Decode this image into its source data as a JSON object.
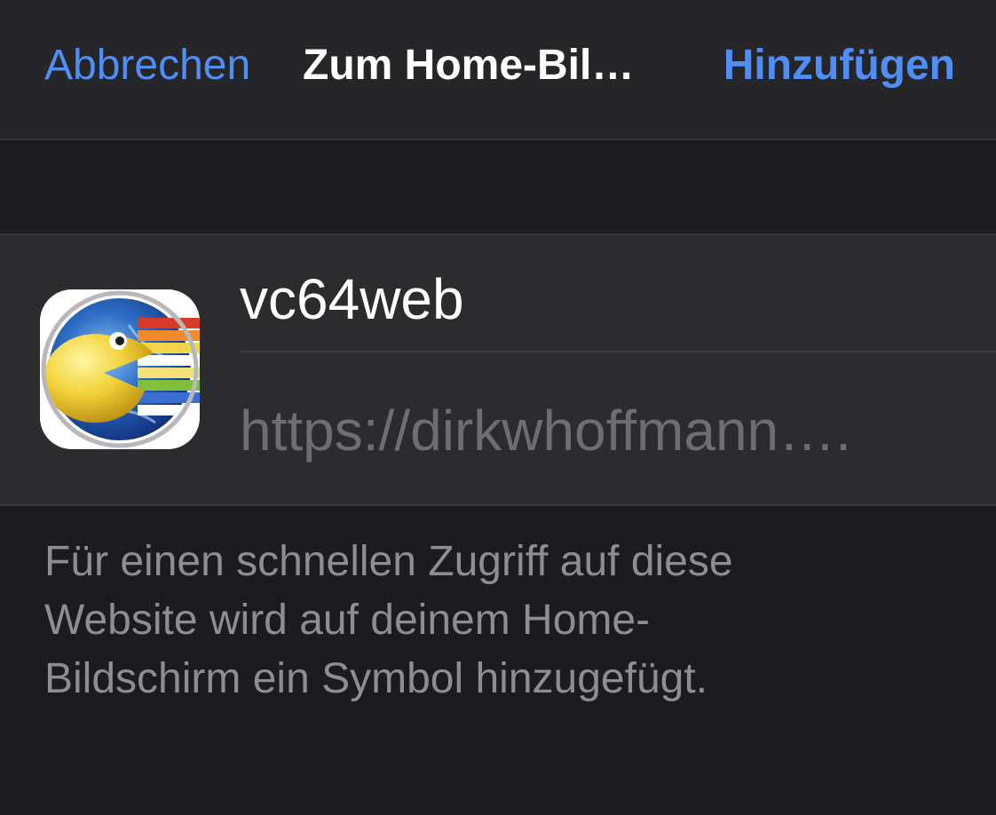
{
  "navbar": {
    "cancel_label": "Abbrechen",
    "title": "Zum Home-Bil…",
    "add_label": "Hinzufügen"
  },
  "bookmark": {
    "name_value": "vc64web",
    "url_text": "https://dirkwhoffmann…."
  },
  "footer": {
    "lines": [
      "Für einen schnellen Zugriff auf diese",
      "Website wird auf deinem Home-",
      "Bildschirm ein Symbol hinzugefügt."
    ]
  },
  "colors": {
    "accent": "#4f8ef5",
    "background": "#1c1c1e",
    "card": "#2c2c2e",
    "secondary_text": "#8d8d92"
  },
  "icons": {
    "app_icon": "vc64web-pacman-globe-icon"
  }
}
